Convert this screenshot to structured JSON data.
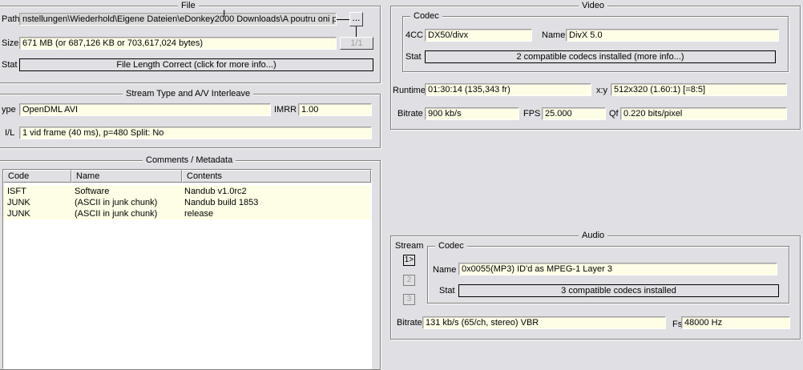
{
  "file": {
    "title": "File",
    "path_label": "Path",
    "path_value": "nstellungen\\Wiederhold\\Eigene Dateien\\eDonkey2000 Downloads\\A poutru oni p",
    "browse_label": "...",
    "size_label": "Size",
    "size_value": "671 MB (or 687,126 KB or 703,617,024 bytes)",
    "part_label": "1/1",
    "stat_label": "Stat",
    "stat_value": "File Length Correct (click for more info...)"
  },
  "stream": {
    "title": "Stream Type and A/V Interleave",
    "type_label": "ype",
    "type_value": "OpenDML AVI",
    "imrr_label": "IMRR",
    "imrr_value": "1.00",
    "il_label": "I/L",
    "il_value": "1 vid frame (40 ms), p=480  Split: No"
  },
  "comments": {
    "title": "Comments / Metadata",
    "columns": [
      "Code",
      "Name",
      "Contents"
    ],
    "rows": [
      {
        "code": "ISFT",
        "name": "Software",
        "contents": "Nandub v1.0rc2"
      },
      {
        "code": "JUNK",
        "name": "(ASCII in junk chunk)",
        "contents": "Nandub build 1853"
      },
      {
        "code": "JUNK",
        "name": "(ASCII in junk chunk)",
        "contents": "release"
      }
    ]
  },
  "video": {
    "title": "Video",
    "codec_title": "Codec",
    "fourcc_label": "4CC",
    "fourcc_value": "DX50/divx",
    "name_label": "Name",
    "name_value": "DivX 5.0",
    "stat_label": "Stat",
    "stat_value": "2 compatible codecs installed (more info...)",
    "runtime_label": "Runtime",
    "runtime_value": "01:30:14 (135,343 fr)",
    "xy_label": "x:y",
    "xy_value": "512x320 (1.60:1) [=8:5]",
    "bitrate_label": "Bitrate",
    "bitrate_value": "900 kb/s",
    "fps_label": "FPS",
    "fps_value": "25.000",
    "qf_label": "Qf",
    "qf_value": "0.220 bits/pixel"
  },
  "audio": {
    "title": "Audio",
    "stream_label": "Stream",
    "streams": [
      "1>",
      "2",
      "3"
    ],
    "codec_title": "Codec",
    "name_label": "Name",
    "name_value": "0x0055(MP3) ID'd as MPEG-1 Layer 3",
    "stat_label": "Stat",
    "stat_value": "3 compatible codecs installed",
    "bitrate_label": "Bitrate",
    "bitrate_value": "131 kb/s (65/ch, stereo) VBR",
    "fs_label": "Fs",
    "fs_value": "48000 Hz"
  }
}
